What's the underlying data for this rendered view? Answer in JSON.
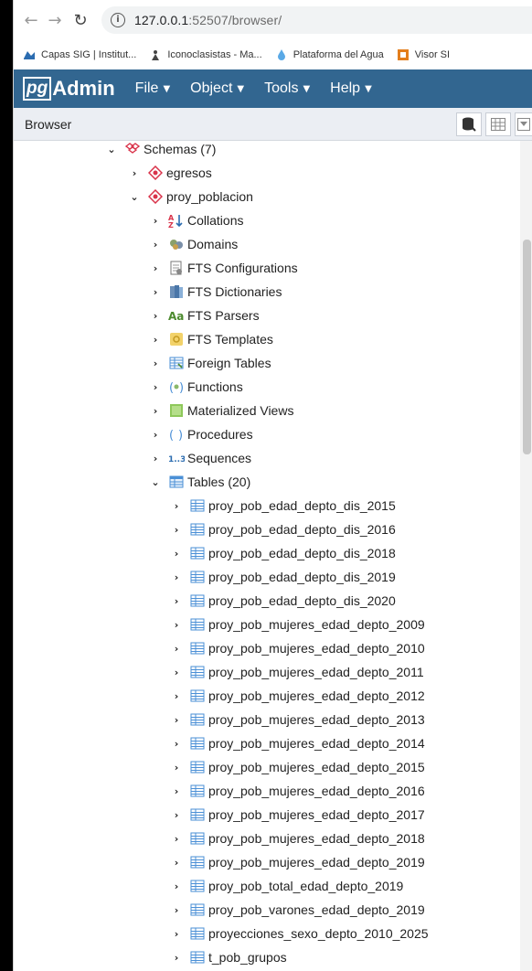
{
  "browser": {
    "url_host": "127.0.0.1",
    "url_path": ":52507/browser/"
  },
  "bookmarks": [
    {
      "label": "Capas SIG | Institut...",
      "icon": "map-icon"
    },
    {
      "label": "Iconoclasistas - Ma...",
      "icon": "person-icon"
    },
    {
      "label": "Plataforma del Agua",
      "icon": "water-drop-icon"
    },
    {
      "label": "Visor SI",
      "icon": "visor-icon"
    }
  ],
  "app": {
    "logo_box": "pg",
    "logo_rest": "Admin",
    "menus": [
      "File",
      "Object",
      "Tools",
      "Help"
    ]
  },
  "panel": {
    "title": "Browser"
  },
  "tree": {
    "schemas": "Schemas (7)",
    "egresos": "egresos",
    "proy_poblacion": "proy_poblacion",
    "objects": [
      "Collations",
      "Domains",
      "FTS Configurations",
      "FTS Dictionaries",
      "FTS Parsers",
      "FTS Templates",
      "Foreign Tables",
      "Functions",
      "Materialized Views",
      "Procedures",
      "Sequences"
    ],
    "tables_label": "Tables (20)",
    "tables": [
      "proy_pob_edad_depto_dis_2015",
      "proy_pob_edad_depto_dis_2016",
      "proy_pob_edad_depto_dis_2018",
      "proy_pob_edad_depto_dis_2019",
      "proy_pob_edad_depto_dis_2020",
      "proy_pob_mujeres_edad_depto_2009",
      "proy_pob_mujeres_edad_depto_2010",
      "proy_pob_mujeres_edad_depto_2011",
      "proy_pob_mujeres_edad_depto_2012",
      "proy_pob_mujeres_edad_depto_2013",
      "proy_pob_mujeres_edad_depto_2014",
      "proy_pob_mujeres_edad_depto_2015",
      "proy_pob_mujeres_edad_depto_2016",
      "proy_pob_mujeres_edad_depto_2017",
      "proy_pob_mujeres_edad_depto_2018",
      "proy_pob_mujeres_edad_depto_2019",
      "proy_pob_total_edad_depto_2019",
      "proy_pob_varones_edad_depto_2019",
      "proyecciones_sexo_depto_2010_2025",
      "t_pob_grupos"
    ]
  },
  "colors": {
    "navbar": "#326690",
    "panel_header": "#ebeef3",
    "schema_red": "#d9334a",
    "table_blue": "#4a8fd6"
  }
}
